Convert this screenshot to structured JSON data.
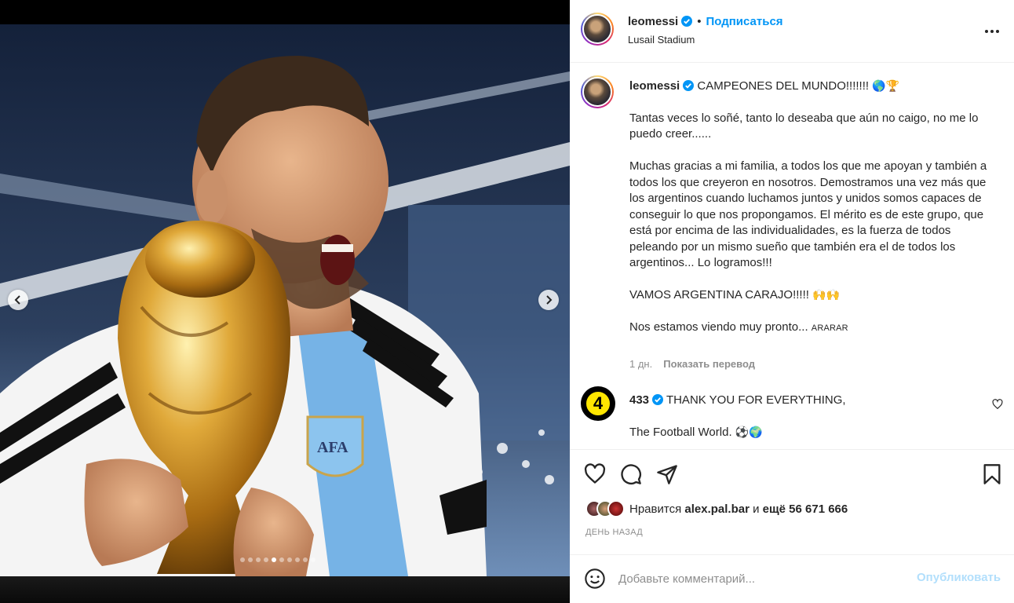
{
  "post": {
    "username": "leomessi",
    "follow_label": "Подписаться",
    "location": "Lusail Stadium",
    "more_icon": "more-horizontal-icon"
  },
  "media": {
    "image_count": 10,
    "active_index": 4,
    "prev_icon": "chevron-left-icon",
    "next_icon": "chevron-right-icon"
  },
  "caption": {
    "username": "leomessi",
    "title": "CAMPEONES DEL MUNDO!!!!!!!",
    "title_emoji": "🌎🏆",
    "paragraphs": [
      "Tantas veces lo soñé, tanto lo deseaba que aún no caigo, no me lo puedo creer......",
      "Muchas gracias a mi familia, a todos los que me apoyan y también a todos los que creyeron en nosotros. Demostramos una vez más que los argentinos cuando luchamos juntos y unidos somos capaces de conseguir lo que nos propongamos. El mérito es de este grupo, que está por encima de las individualidades, es la fuerza de todos peleando por un mismo sueño que también era el de todos los argentinos... Lo logramos!!!",
      "VAMOS ARGENTINA CARAJO!!!!!",
      "Nos estamos viendo muy pronto..."
    ],
    "shout_emoji": "🙌🙌",
    "flags": "ARARAR",
    "time": "1 дн.",
    "translate_label": "Показать перевод"
  },
  "comment": {
    "avatar_text": "4",
    "username": "433",
    "line1": "THANK YOU FOR EVERYTHING,",
    "line2": "The Football World.",
    "line2_emoji": "⚽🌍",
    "like_icon": "heart-outline-icon"
  },
  "actions": {
    "like_icon": "heart-icon",
    "comment_icon": "comment-icon",
    "share_icon": "send-icon",
    "save_icon": "bookmark-icon"
  },
  "likes": {
    "prefix": "Нравится",
    "user": "alex.pal.bar",
    "middle": "и",
    "count": "ещё 56 671 666"
  },
  "time_ago": "ДЕНЬ НАЗАД",
  "composer": {
    "placeholder": "Добавьте комментарий...",
    "publish_label": "Опубликовать",
    "emoji_icon": "smile-icon"
  },
  "colors": {
    "accent": "#0095f6",
    "publish_disabled": "#b2dffc",
    "text": "#262626",
    "secondary": "#8e8e8e"
  }
}
